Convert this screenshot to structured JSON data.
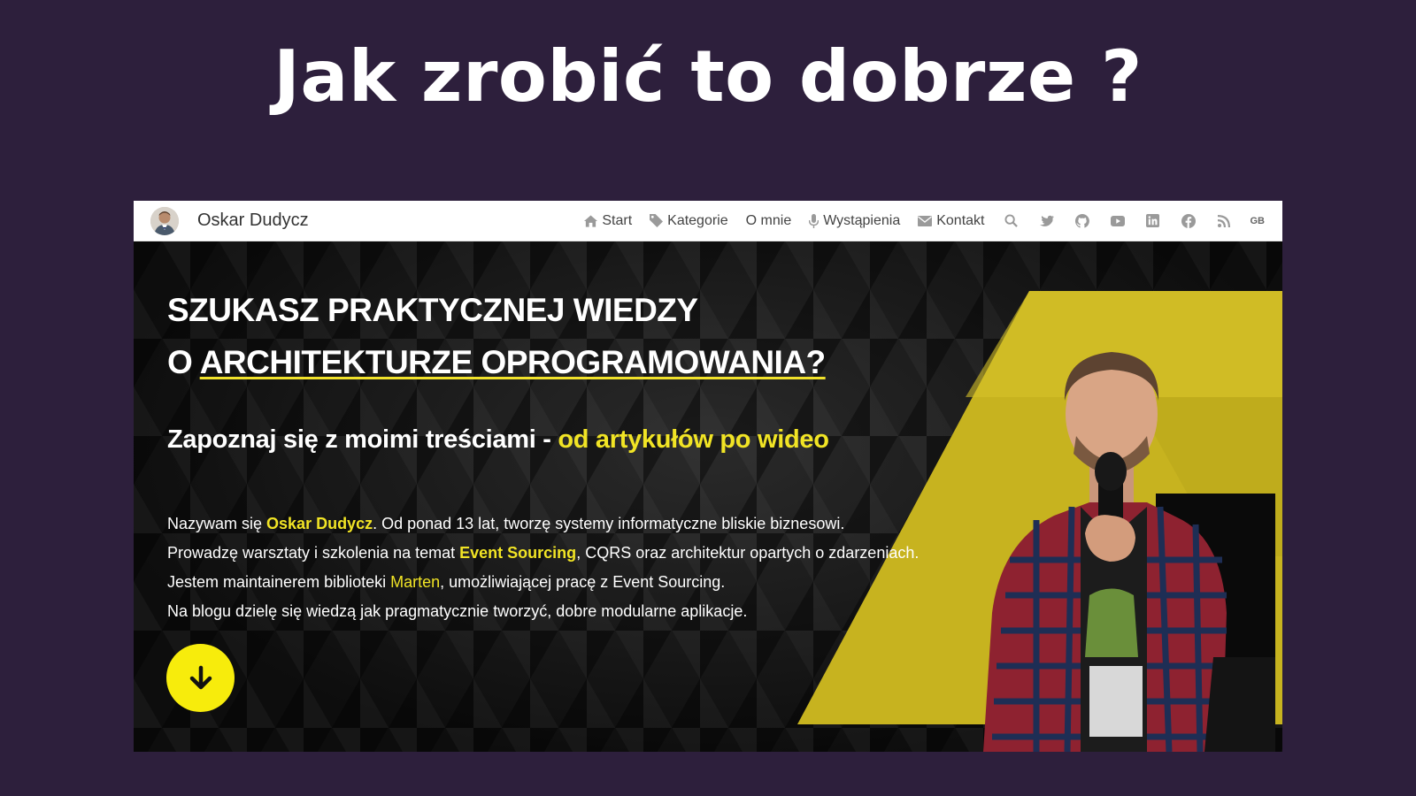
{
  "slide": {
    "title": "Jak zrobić to dobrze ?"
  },
  "nav": {
    "brand": "Oskar Dudycz",
    "items": [
      {
        "label": "Start",
        "icon": "home-icon"
      },
      {
        "label": "Kategorie",
        "icon": "tag-icon"
      },
      {
        "label": "O mnie",
        "icon": ""
      },
      {
        "label": "Wystąpienia",
        "icon": "microphone-icon"
      },
      {
        "label": "Kontakt",
        "icon": "envelope-icon"
      }
    ],
    "social_icons": [
      "search-icon",
      "twitter-icon",
      "github-icon",
      "youtube-icon",
      "linkedin-icon",
      "facebook-icon",
      "rss-icon"
    ],
    "lang": "GB"
  },
  "hero": {
    "headline_line1": "SZUKASZ PRAKTYCZNEJ WIEDZY",
    "headline_line2_prefix": "O ",
    "headline_line2_link": "ARCHITEKTURZE OPROGRAMOWANIA?",
    "subheadline_white": "Zapoznaj się z moimi treściami - ",
    "subheadline_yellow": "od artykułów po wideo",
    "p1_a": "Nazywam się ",
    "p1_b": "Oskar Dudycz",
    "p1_c": ". Od ponad 13 lat, tworzę systemy informatyczne bliskie biznesowi.",
    "p2_a": "Prowadzę warsztaty i szkolenia na temat ",
    "p2_b": "Event Sourcing",
    "p2_c": ", CQRS oraz architektur opartych o zdarzeniach.",
    "p3_a": "Jestem maintainerem biblioteki ",
    "p3_b": "Marten",
    "p3_c": ", umożliwiającej pracę z Event Sourcing.",
    "p4": "Na blogu dzielę się wiedzą jak pragmatycznie tworzyć, dobre modularne aplikacje."
  },
  "colors": {
    "background": "#2d1f3c",
    "accent": "#f1e425",
    "hero_bg": "#0f0f0f"
  }
}
